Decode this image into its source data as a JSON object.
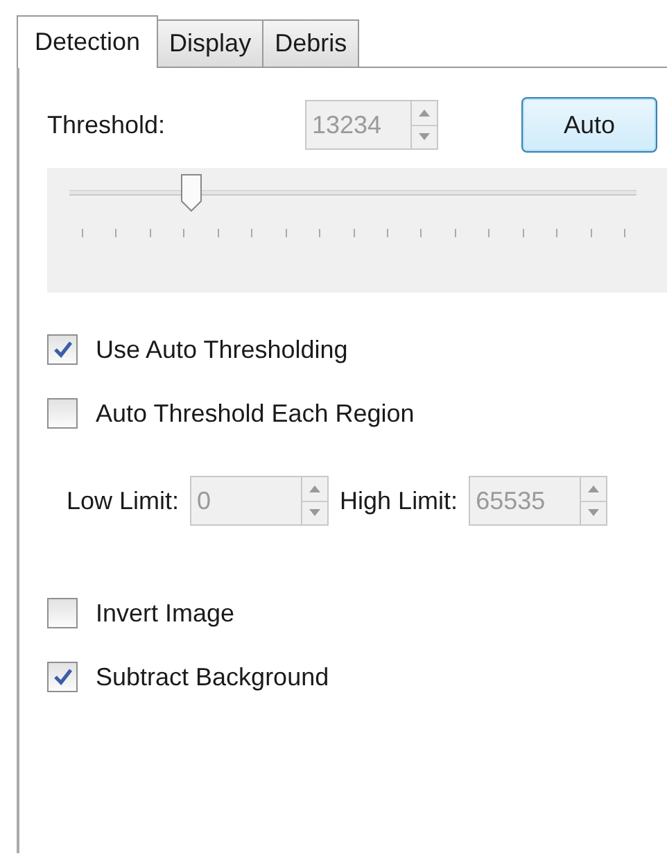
{
  "tabs": [
    {
      "label": "Detection",
      "selected": true
    },
    {
      "label": "Display",
      "selected": false
    },
    {
      "label": "Debris",
      "selected": false
    }
  ],
  "threshold": {
    "label": "Threshold:",
    "value": "13234",
    "disabled": true
  },
  "auto_button": {
    "label": "Auto",
    "focused": true
  },
  "slider": {
    "level": 0.216
  },
  "options_top": [
    {
      "label": "Use Auto Thresholding",
      "checked": true
    },
    {
      "label": "Auto Threshold Each Region",
      "checked": false
    }
  ],
  "limits": [
    {
      "label": "Low Limit:",
      "value": "0",
      "disabled": true
    },
    {
      "label": "High Limit:",
      "value": "65535",
      "disabled": true
    }
  ],
  "options_bottom": [
    {
      "label": "Invert Image",
      "checked": false
    },
    {
      "label": "Subtract Background",
      "checked": true
    }
  ]
}
